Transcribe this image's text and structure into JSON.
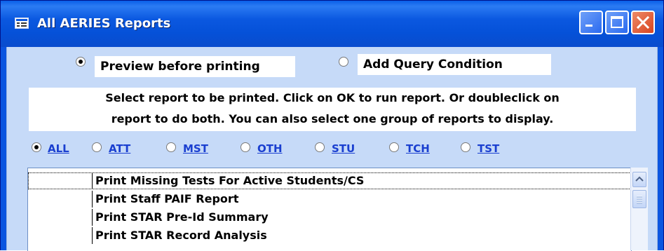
{
  "window": {
    "title": "All AERIES Reports"
  },
  "options": {
    "preview": {
      "label": "Preview before printing",
      "checked": true
    },
    "query": {
      "label": "Add Query Condition",
      "checked": false
    }
  },
  "instructions": {
    "line1": "Select report to be printed.  Click on OK to run report.  Or doubleclick on",
    "line2": "report  to do both.  You can also select one group of reports to display."
  },
  "groups": [
    {
      "label": "ALL",
      "checked": true
    },
    {
      "label": "ATT",
      "checked": false
    },
    {
      "label": "MST",
      "checked": false
    },
    {
      "label": "OTH",
      "checked": false
    },
    {
      "label": "STU",
      "checked": false
    },
    {
      "label": "TCH",
      "checked": false
    },
    {
      "label": "TST",
      "checked": false
    }
  ],
  "reports": [
    {
      "name": "Print Missing Tests For Active Students/CS",
      "selected": true
    },
    {
      "name": "Print Staff PAIF Report",
      "selected": false
    },
    {
      "name": "Print STAR Pre-Id Summary",
      "selected": false
    },
    {
      "name": "Print STAR Record Analysis",
      "selected": false
    }
  ],
  "icons": {
    "title": "app-window-icon",
    "minimize": "minimize-icon",
    "maximize": "maximize-icon",
    "close": "close-icon",
    "scroll_up": "chevron-up-icon"
  }
}
